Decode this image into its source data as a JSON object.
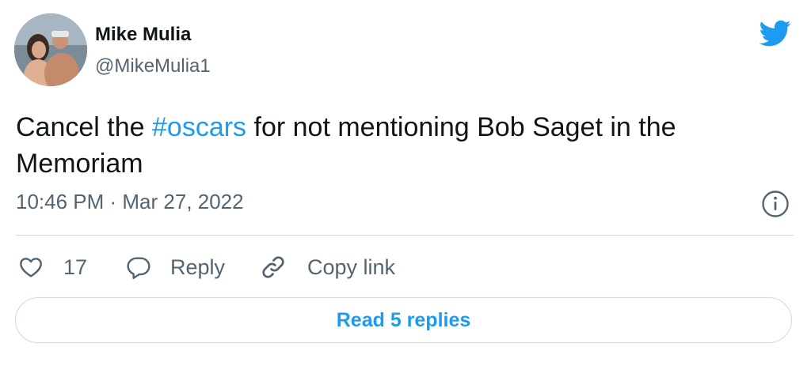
{
  "author": {
    "name": "Mike Mulia",
    "handle": "@MikeMulia1",
    "avatar_icon": "profile-photo"
  },
  "tweet": {
    "text_before": "Cancel the ",
    "hashtag": "#oscars",
    "text_after": " for not mentioning Bob Saget in the Memoriam",
    "timestamp": "10:46 PM · Mar 27, 2022"
  },
  "actions": {
    "like_count": "17",
    "reply_label": "Reply",
    "copy_link_label": "Copy link"
  },
  "footer": {
    "read_replies_label": "Read 5 replies"
  },
  "colors": {
    "accent": "#1d9bf0",
    "text": "#0f1419",
    "muted": "#536471",
    "border": "#cfd9de"
  },
  "icons": [
    "twitter-bird-icon",
    "info-icon",
    "heart-icon",
    "reply-bubble-icon",
    "link-icon"
  ]
}
